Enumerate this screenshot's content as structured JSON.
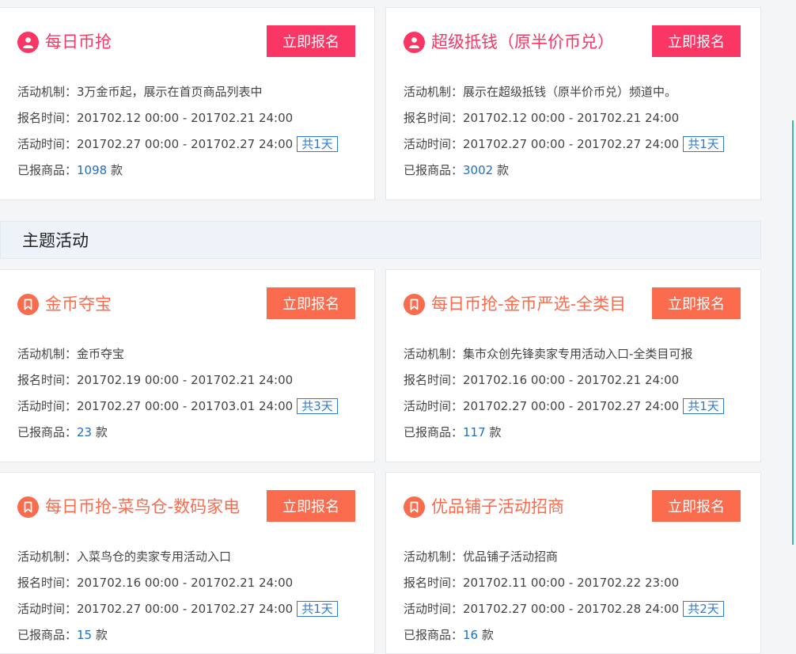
{
  "colors": {
    "brand_pink": "#fa3664",
    "brand_orange": "#fb6b4e",
    "count_blue": "#1f6fc5",
    "days_blue": "#2d7bd4"
  },
  "section": {
    "title": "主题活动"
  },
  "labels": {
    "mechanism": "活动机制：",
    "signup_time": "报名时间：",
    "activity_time": "活动时间：",
    "registered": "已报商品：",
    "unit": "款"
  },
  "cards": [
    {
      "title": "每日币抢",
      "icon": "user-icon",
      "button": "立即报名",
      "mechanism": "3万金币起，展示在首页商品列表中",
      "signup_time": "201702.12 00:00 - 201702.21 24:00",
      "activity_time": "201702.27 00:00 - 201702.27 24:00",
      "days": "共1天",
      "registered": "1098"
    },
    {
      "title": "超级抵钱（原半价币兑）",
      "icon": "user-icon",
      "button": "立即报名",
      "mechanism": "展示在超级抵钱（原半价币兑）频道中。",
      "signup_time": "201702.12 00:00 - 201702.21 24:00",
      "activity_time": "201702.27 00:00 - 201702.27 24:00",
      "days": "共1天",
      "registered": "3002"
    },
    {
      "title": "金币夺宝",
      "icon": "bookmark-icon",
      "button": "立即报名",
      "mechanism": "金币夺宝",
      "signup_time": "201702.19 00:00 - 201702.21 24:00",
      "activity_time": "201702.27 00:00 - 201703.01 24:00",
      "days": "共3天",
      "registered": "23"
    },
    {
      "title": "每日币抢-金币严选-全类目",
      "icon": "bookmark-icon",
      "button": "立即报名",
      "mechanism": "集市众创先锋卖家专用活动入口-全类目可报",
      "signup_time": "201702.16 00:00 - 201702.21 24:00",
      "activity_time": "201702.27 00:00 - 201702.27 24:00",
      "days": "共1天",
      "registered": "117"
    },
    {
      "title": "每日币抢-菜鸟仓-数码家电",
      "icon": "bookmark-icon",
      "button": "立即报名",
      "mechanism": "入菜鸟仓的卖家专用活动入口",
      "signup_time": "201702.16 00:00 - 201702.21 24:00",
      "activity_time": "201702.27 00:00 - 201702.27 24:00",
      "days": "共1天",
      "registered": "15"
    },
    {
      "title": "优品铺子活动招商",
      "icon": "bookmark-icon",
      "button": "立即报名",
      "mechanism": "优品铺子活动招商",
      "signup_time": "201702.11 00:00 - 201702.22 23:00",
      "activity_time": "201702.27 00:00 - 201702.28 24:00",
      "days": "共2天",
      "registered": "16"
    }
  ]
}
